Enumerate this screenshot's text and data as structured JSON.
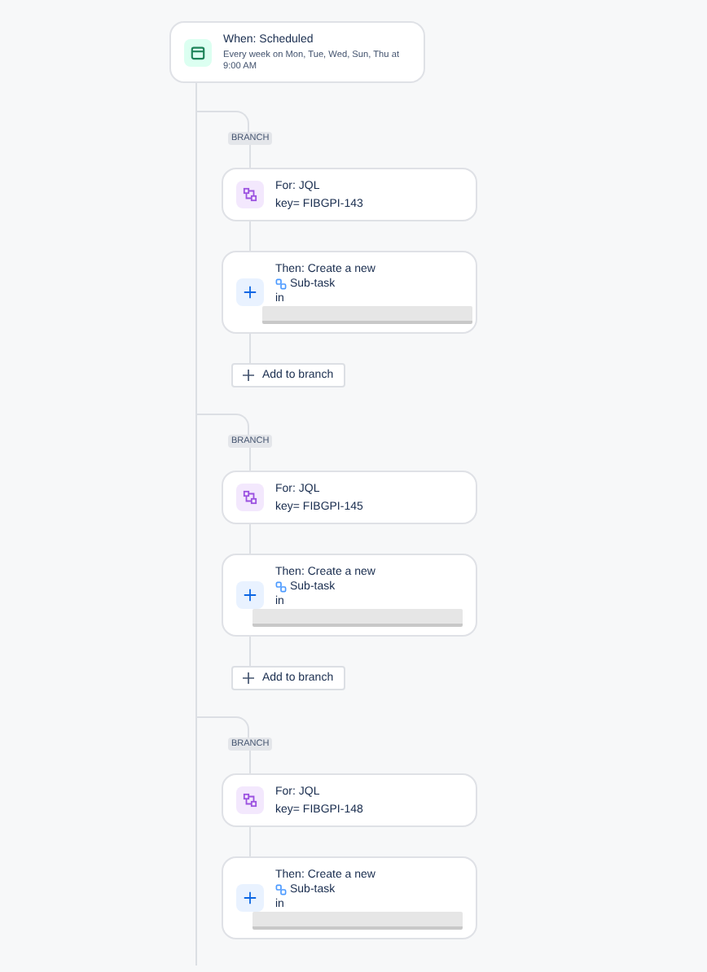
{
  "trigger": {
    "title": "When: Scheduled",
    "description": "Every week on Mon, Tue, Wed, Sun, Thu at 9:00 AM"
  },
  "branches": [
    {
      "label": "BRANCH",
      "condition": {
        "title": "For: JQL",
        "query": "key= FIBGPI-143"
      },
      "action": {
        "title": "Then: Create a new",
        "issue_type": "Sub-task",
        "target": "in"
      },
      "add_button": "Add to branch"
    },
    {
      "label": "BRANCH",
      "condition": {
        "title": "For: JQL",
        "query": "key= FIBGPI-145"
      },
      "action": {
        "title": "Then: Create a new",
        "issue_type": "Sub-task",
        "target": "in"
      },
      "add_button": "Add to branch"
    },
    {
      "label": "BRANCH",
      "condition": {
        "title": "For: JQL",
        "query": "key= FIBGPI-148"
      },
      "action": {
        "title": "Then: Create a new",
        "issue_type": "Sub-task",
        "target": "in"
      }
    }
  ]
}
